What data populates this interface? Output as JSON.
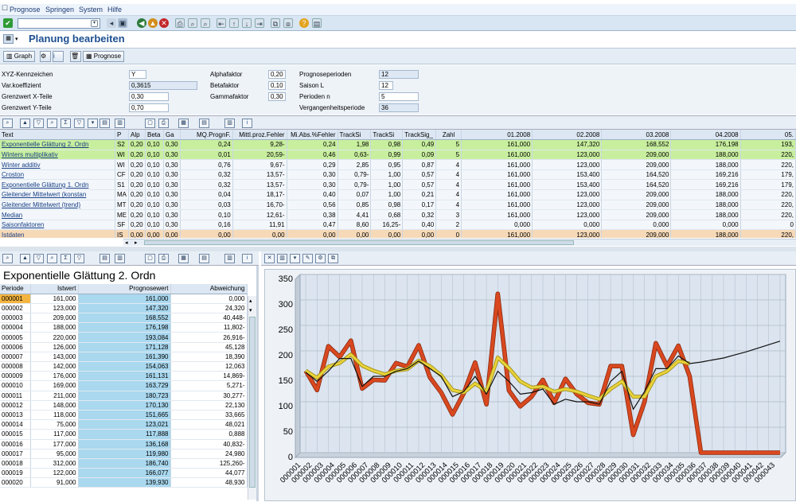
{
  "menu": {
    "items": [
      "Prognose",
      "Springen",
      "System",
      "Hilfe"
    ]
  },
  "page": {
    "title": "Planung bearbeiten"
  },
  "appbar": {
    "graph": "Graph",
    "prognose": "Prognose"
  },
  "params": {
    "xyz_label": "XYZ-Kennzeichen",
    "xyz_value": "Y",
    "varkoef_label": "Var.koeffizient",
    "varkoef_value": "0,3615",
    "gx_label": "Grenzwert X-Teile",
    "gx_value": "0,30",
    "gy_label": "Grenzwert Y-Teile",
    "gy_value": "0,70",
    "alpha_label": "Alphafaktor",
    "alpha_value": "0,20",
    "beta_label": "Betafaktor",
    "beta_value": "0,10",
    "gamma_label": "Gammafaktor",
    "gamma_value": "0,30",
    "pp_label": "Prognoseperioden",
    "pp_value": "12",
    "saison_label": "Saison L",
    "saison_value": "12",
    "pern_label": "Perioden n",
    "pern_value": "5",
    "vp_label": "Vergangenheitsperiode",
    "vp_value": "36"
  },
  "grid": {
    "headers": [
      "Text",
      "P",
      "Alp",
      "Beta",
      "Ga",
      "MQ.PrognF.",
      "Mittl.proz.Fehler",
      "Mi.Abs.%Fehler",
      "TrackSi",
      "TrackSi",
      "TrackSig_",
      "Zahl",
      "01.2008",
      "02.2008",
      "03.2008",
      "04.2008",
      "05."
    ],
    "rows": [
      [
        "Exponentielle Glättung 2. Ordn",
        "S2",
        "0,20",
        "0,10",
        "0,30",
        "0,24",
        "9,28-",
        "0,24",
        "1,98",
        "0,98",
        "0,49",
        "5",
        "161,000",
        "147,320",
        "168,552",
        "176,198",
        "193,"
      ],
      [
        "Winters multiplikativ",
        "WI",
        "0,20",
        "0,10",
        "0,30",
        "0,01",
        "20,59-",
        "0,46",
        "0,63-",
        "0,99",
        "0,09",
        "5",
        "161,000",
        "123,000",
        "209,000",
        "188,000",
        "220,"
      ],
      [
        "Winter additiv",
        "WI",
        "0,20",
        "0,10",
        "0,30",
        "0,76",
        "9,67-",
        "0,29",
        "2,85",
        "0,95",
        "0,87",
        "4",
        "161,000",
        "123,000",
        "209,000",
        "188,000",
        "220,"
      ],
      [
        "Croston",
        "CF",
        "0,20",
        "0,10",
        "0,30",
        "0,32",
        "13,57-",
        "0,30",
        "0,79-",
        "1,00",
        "0,57",
        "4",
        "161,000",
        "153,400",
        "164,520",
        "169,216",
        "179,"
      ],
      [
        "Exponentielle Glättung 1. Ordn",
        "S1",
        "0,20",
        "0,10",
        "0,30",
        "0,32",
        "13,57-",
        "0,30",
        "0,79-",
        "1,00",
        "0,57",
        "4",
        "161,000",
        "153,400",
        "164,520",
        "169,216",
        "179,"
      ],
      [
        "Gleitender Mittelwert (konstan",
        "MA",
        "0,20",
        "0,10",
        "0,30",
        "0,04",
        "18,17-",
        "0,40",
        "0,07",
        "1,00",
        "0,21",
        "4",
        "161,000",
        "123,000",
        "209,000",
        "188,000",
        "220,"
      ],
      [
        "Gleitender Mittelwert (trend)",
        "MT",
        "0,20",
        "0,10",
        "0,30",
        "0,03",
        "16,70-",
        "0,56",
        "0,85",
        "0,98",
        "0,17",
        "4",
        "161,000",
        "123,000",
        "209,000",
        "188,000",
        "220,"
      ],
      [
        "Median",
        "ME",
        "0,20",
        "0,10",
        "0,30",
        "0,10",
        "12,61-",
        "0,38",
        "4,41",
        "0,68",
        "0,32",
        "3",
        "161,000",
        "123,000",
        "209,000",
        "188,000",
        "220,"
      ],
      [
        "Saisonfaktoren",
        "SF",
        "0,20",
        "0,10",
        "0,30",
        "0,16",
        "11,91",
        "0,47",
        "8,60",
        "16,25-",
        "0,40",
        "2",
        "0,000",
        "0,000",
        "0,000",
        "0,000",
        "0"
      ],
      [
        "Istdaten",
        "IS",
        "0,00",
        "0,00",
        "0,00",
        "0,00",
        "0,00",
        "0,00",
        "0,00",
        "0,00",
        "0,00",
        "0",
        "161,000",
        "123,000",
        "209,000",
        "188,000",
        "220,"
      ]
    ]
  },
  "left": {
    "title": "Exponentielle Glättung 2. Ordn",
    "headers": [
      "Periode",
      "Istwert",
      "Prognosewert",
      "Abweichung"
    ],
    "rows": [
      [
        "000001",
        "161,000",
        "161,000",
        "0,000"
      ],
      [
        "000002",
        "123,000",
        "147,320",
        "24,320"
      ],
      [
        "000003",
        "209,000",
        "168,552",
        "40,448-"
      ],
      [
        "000004",
        "188,000",
        "176,198",
        "11,802-"
      ],
      [
        "000005",
        "220,000",
        "193,084",
        "26,916-"
      ],
      [
        "000006",
        "126,000",
        "171,128",
        "45,128"
      ],
      [
        "000007",
        "143,000",
        "161,390",
        "18,390"
      ],
      [
        "000008",
        "142,000",
        "154,063",
        "12,063"
      ],
      [
        "000009",
        "176,000",
        "161,131",
        "14,869-"
      ],
      [
        "000010",
        "169,000",
        "163,729",
        "5,271-"
      ],
      [
        "000011",
        "211,000",
        "180,723",
        "30,277-"
      ],
      [
        "000012",
        "148,000",
        "170,130",
        "22,130"
      ],
      [
        "000013",
        "118,000",
        "151,665",
        "33,665"
      ],
      [
        "000014",
        "75,000",
        "123,021",
        "48,021"
      ],
      [
        "000015",
        "117,000",
        "117,888",
        "0,888"
      ],
      [
        "000016",
        "177,000",
        "136,168",
        "40,832-"
      ],
      [
        "000017",
        "95,000",
        "119,980",
        "24,980"
      ],
      [
        "000018",
        "312,000",
        "186,740",
        "125,260-"
      ],
      [
        "000019",
        "122,000",
        "166,077",
        "44,077"
      ],
      [
        "000020",
        "91,000",
        "139,930",
        "48,930"
      ]
    ]
  },
  "chart_data": {
    "type": "line",
    "ylim": [
      0,
      350
    ],
    "yticks": [
      0,
      50,
      100,
      150,
      200,
      250,
      300,
      350
    ],
    "x": [
      "000001",
      "000002",
      "000003",
      "000004",
      "000005",
      "000006",
      "000007",
      "000008",
      "000009",
      "000010",
      "000011",
      "000012",
      "000013",
      "000014",
      "000015",
      "000016",
      "000017",
      "000018",
      "000019",
      "000020",
      "000021",
      "000022",
      "000023",
      "000024",
      "000025",
      "000026",
      "000027",
      "000028",
      "000029",
      "000030",
      "000031",
      "000032",
      "000033",
      "000034",
      "000035",
      "000036",
      "000037",
      "000038",
      "000039",
      "000040",
      "000041",
      "000042",
      "000043"
    ],
    "series": [
      {
        "color": "#d9481f",
        "values": [
          161,
          123,
          209,
          188,
          220,
          126,
          143,
          142,
          176,
          169,
          211,
          148,
          118,
          75,
          117,
          177,
          95,
          312,
          122,
          91,
          110,
          143,
          98,
          145,
          115,
          98,
          95,
          170,
          170,
          35,
          100,
          215,
          170,
          210,
          150,
          0,
          0,
          0,
          0,
          0,
          0,
          0,
          0
        ]
      },
      {
        "color": "#e8d23a",
        "values": [
          161,
          147,
          169,
          176,
          193,
          171,
          161,
          154,
          161,
          164,
          181,
          170,
          152,
          123,
          118,
          136,
          120,
          187,
          166,
          140,
          128,
          130,
          120,
          125,
          120,
          112,
          105,
          125,
          140,
          110,
          110,
          150,
          160,
          180,
          175,
          null,
          null,
          null,
          null,
          null,
          null,
          null,
          null
        ]
      },
      {
        "color": "#111111",
        "values": [
          158,
          140,
          160,
          185,
          185,
          130,
          150,
          150,
          160,
          165,
          180,
          165,
          150,
          110,
          120,
          150,
          115,
          160,
          140,
          115,
          118,
          125,
          95,
          105,
          100,
          100,
          95,
          140,
          160,
          85,
          120,
          165,
          165,
          190,
          175,
          178,
          182,
          186,
          192,
          198,
          205,
          212,
          219
        ]
      }
    ]
  }
}
